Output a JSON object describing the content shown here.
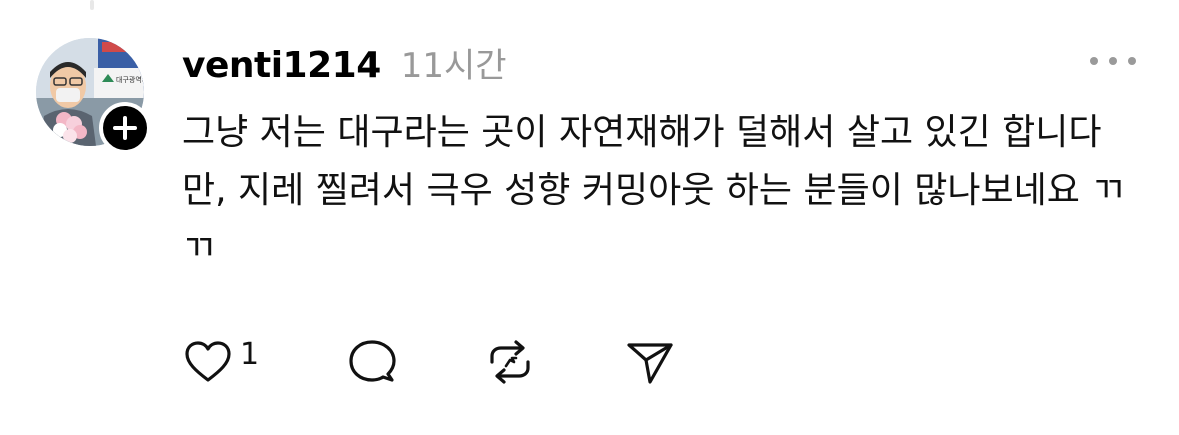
{
  "post": {
    "username": "venti1214",
    "timestamp": "11시간",
    "text": "그냥 저는 대구라는 곳이 자연재해가 덜해서 살고 있긴 합니다만, 지레 찔려서 극우 성향 커밍아웃 하는 분들이 많나보네요 ㄲㄲ",
    "like_count": "1",
    "avatar_sign_text": "대구광역시"
  },
  "icons": {
    "follow": "plus-icon",
    "more": "more-dots-icon",
    "like": "heart-icon",
    "reply": "comment-icon",
    "repost": "repost-icon",
    "share": "send-icon"
  },
  "colors": {
    "text": "#111111",
    "timestamp": "#999999",
    "badge": "#000000"
  }
}
